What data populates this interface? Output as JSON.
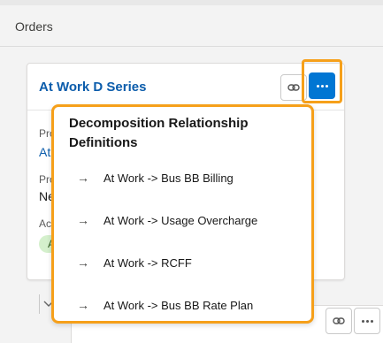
{
  "header": {
    "title": "Orders"
  },
  "card": {
    "title": "At Work D Series",
    "fields": [
      {
        "label": "Pro",
        "value": "At",
        "kind": "link"
      },
      {
        "label": "Pro",
        "value": "Ne",
        "kind": "text"
      },
      {
        "label": "Ac",
        "value": "A",
        "kind": "badge"
      }
    ]
  },
  "menu": {
    "title": "Decomposition Relationship Definitions",
    "items": [
      "At Work -> Bus BB Billing",
      "At Work -> Usage Overcharge",
      "At Work -> RCFF",
      "At Work -> Bus BB Rate Plan"
    ],
    "arrow_glyph": "→"
  },
  "colors": {
    "accent": "#0176d3",
    "highlight": "#f6a01a",
    "link": "#0b5cab",
    "badge_bg": "#d4f0cc"
  },
  "icons": {
    "link": "link-icon",
    "more": "more-actions-icon",
    "chevron": "chevron-down-icon"
  }
}
